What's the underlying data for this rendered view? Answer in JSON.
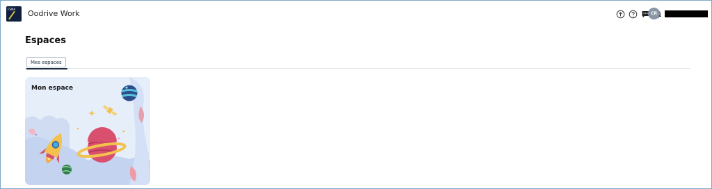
{
  "header": {
    "logo_text": "FSMA",
    "app_title": "Oodrive Work",
    "icons": [
      "info-upload-icon",
      "help-icon",
      "chat-icon",
      "bell-icon"
    ],
    "avatar_initials": "CR"
  },
  "page": {
    "title": "Espaces",
    "tabs": [
      {
        "label": "Mes espaces",
        "active": true
      }
    ]
  },
  "spaces": [
    {
      "title": "Mon espace"
    }
  ],
  "colors": {
    "border": "#7da9c9",
    "logo_bg": "#0f1f3d",
    "card_bg": "#e6eefa",
    "avatar_bg": "#8a96a6",
    "tab_active": "#1d2b40"
  }
}
